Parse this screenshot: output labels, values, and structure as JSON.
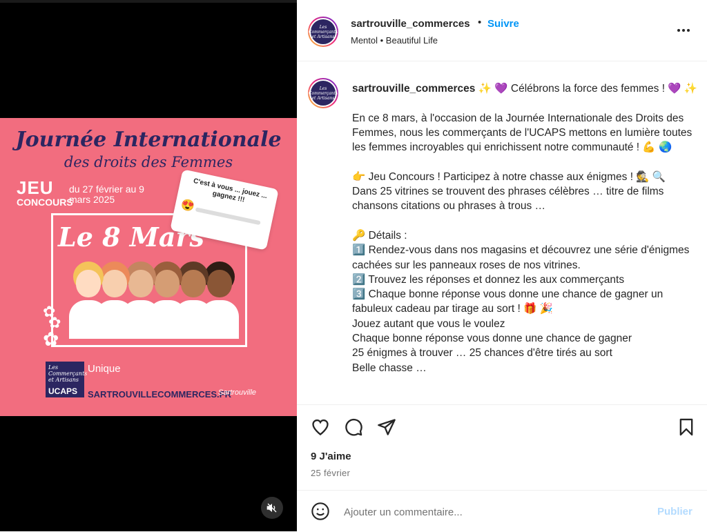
{
  "post": {
    "username": "sartrouville_commerces",
    "follow_label": "Suivre",
    "separator": "•",
    "audio": "Mentol • Beautiful Life",
    "avatar_text": "Les Commerçants et Artisans"
  },
  "poster": {
    "title_line1": "Journée Internationale",
    "title_line2": "des droits des Femmes",
    "jeu": "JEU",
    "concours": "CONCOURS",
    "dates": "du 27 février au 9 mars 2025",
    "le8mars": "Le 8 Mars",
    "bubble_text": "C'est à vous ... jouez ... gagnez !!!",
    "bubble_emoji": "😍",
    "ucaps_small": "Les Commerçants et Artisans",
    "ucaps": "UCAPS",
    "unique": "Unique",
    "site": "SARTROUVILLECOMMERCES.FR",
    "city_logo": "Sartrouville"
  },
  "caption": {
    "username": "sartrouville_commerces",
    "lines": [
      "✨ 💜 Célébrons la force des femmes ! 💜 ✨",
      "",
      "En ce 8 mars, à l'occasion de la Journée Internationale des Droits des Femmes, nous les commerçants de l'UCAPS mettons en lumière toutes les femmes incroyables qui enrichissent notre communauté ! 💪 🌏",
      "",
      "👉 Jeu Concours ! Participez à notre chasse aux énigmes ! 🕵️ 🔍",
      "Dans 25 vitrines se trouvent des phrases célèbres … titre de films chansons citations ou phrases à trous …",
      "",
      "🔑 Détails :",
      "1️⃣ Rendez-vous dans nos magasins et découvrez une série d'énigmes cachées sur les panneaux roses de nos vitrines.",
      "2️⃣ Trouvez les réponses et donnez les aux commerçants",
      "3️⃣ Chaque bonne réponse vous donne une chance de gagner un fabuleux cadeau par tirage au sort ! 🎁 🎉",
      "Jouez autant que vous le voulez",
      "Chaque bonne réponse vous donne une chance de gagner",
      "25 énigmes à trouver … 25 chances d'être tirés au sort",
      "Belle chasse …"
    ]
  },
  "engagement": {
    "likes": "9 J'aime",
    "date": "25 février"
  },
  "comment": {
    "placeholder": "Ajouter un commentaire...",
    "publish": "Publier"
  },
  "icons": {
    "like": "heart-icon",
    "comment": "comment-icon",
    "share": "share-icon",
    "save": "bookmark-icon",
    "more": "more-icon",
    "emoji": "emoji-icon",
    "mute": "mute-icon"
  },
  "colors": {
    "poster_bg": "#f26d7f",
    "accent_blue": "#0095f6",
    "publish_disabled": "#b3dbff",
    "navy": "#2c2661"
  }
}
